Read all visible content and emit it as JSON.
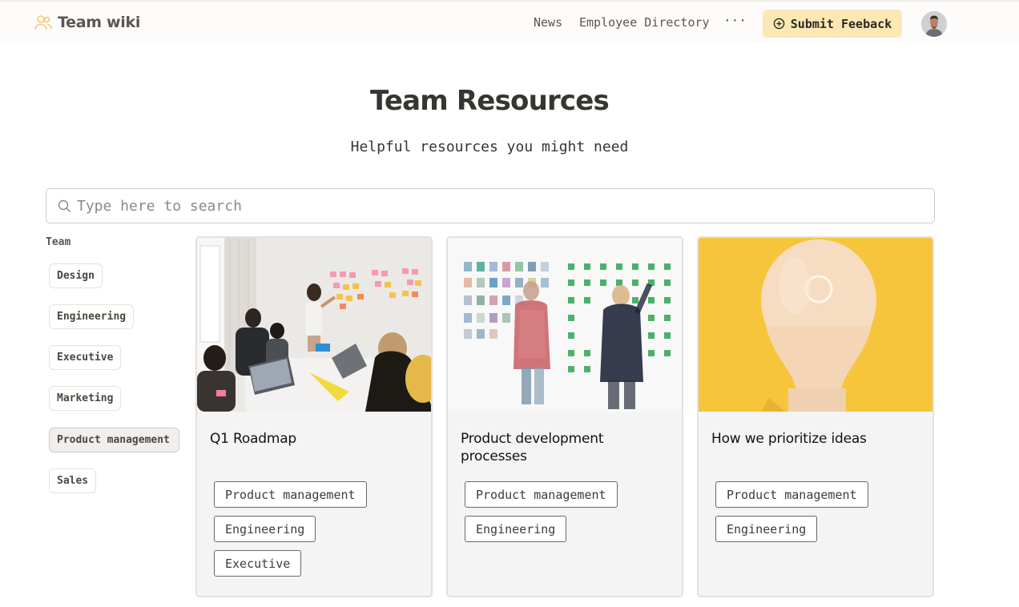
{
  "app": {
    "title": "Team wiki",
    "brand_icon": "people-icon",
    "accent_color": "#f4c874"
  },
  "nav": {
    "items": [
      "News",
      "Employee Directory"
    ],
    "more_label": "···",
    "submit_label": "Submit Feeback",
    "submit_icon": "plus-circle-icon"
  },
  "header": {
    "title": "Team Resources",
    "subtitle": "Helpful resources you might need"
  },
  "search": {
    "placeholder": "Type here to search",
    "value": ""
  },
  "filters": {
    "heading": "Team",
    "items": [
      {
        "label": "Design",
        "active": false
      },
      {
        "label": "Engineering",
        "active": false
      },
      {
        "label": "Executive",
        "active": false
      },
      {
        "label": "Marketing",
        "active": false
      },
      {
        "label": "Product management",
        "active": true
      },
      {
        "label": "Sales",
        "active": false
      }
    ]
  },
  "cards": [
    {
      "title": "Q1 Roadmap",
      "image": "team-meeting-photo",
      "tags": [
        "Product management",
        "Engineering",
        "Executive"
      ]
    },
    {
      "title": "Product development processes",
      "image": "sticky-note-wall-photo",
      "tags": [
        "Product management",
        "Engineering"
      ]
    },
    {
      "title": "How we prioritize ideas",
      "image": "lightbulb-photo",
      "tags": [
        "Product management",
        "Engineering"
      ]
    }
  ]
}
